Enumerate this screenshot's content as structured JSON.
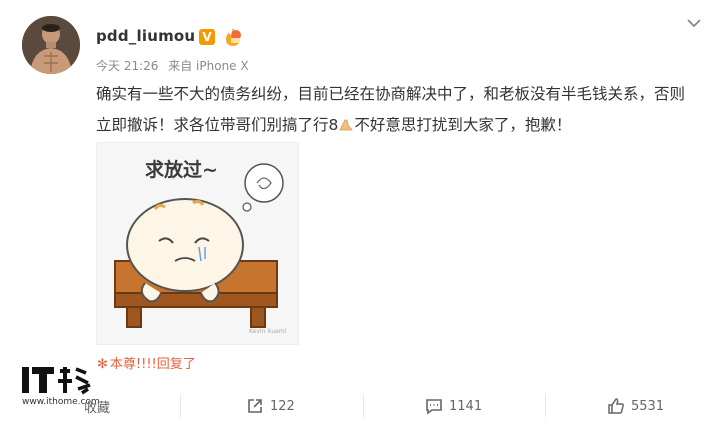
{
  "post": {
    "username": "pdd_liumou",
    "verified_badge": "V",
    "time": "今天 21:26",
    "source": "来自 iPhone X",
    "text_part1": "确实有一些不大的债务纠纷，目前已经在协商解决中了，和老板没有半毛钱关系，否则立即撤诉！求各位带哥们别搞了行8",
    "text_part2": "不好意思打扰到大家了，抱歉！"
  },
  "sticker": {
    "title": "求放过~",
    "watermark": "Kevin Xuemi"
  },
  "reply": {
    "text": "本尊!!!!回复了"
  },
  "watermark": {
    "logo_text": "IT之家",
    "url": "www.ithome.com"
  },
  "actions": {
    "favorite_label": "收藏",
    "share_count": "122",
    "comment_count": "1141",
    "like_count": "5531"
  },
  "colors": {
    "accent": "#e8613a",
    "badge": "#f29a00",
    "meta_text": "#8a8a8a"
  }
}
